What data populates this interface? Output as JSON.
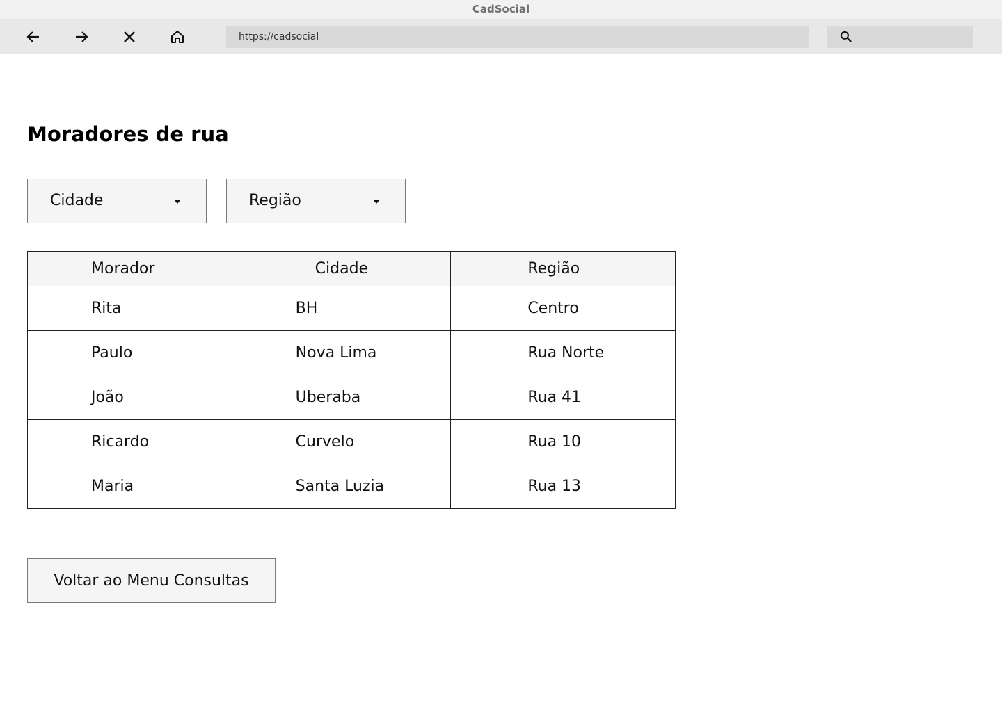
{
  "window": {
    "title": "CadSocial"
  },
  "browser": {
    "url": "https://cadsocial",
    "icons": {
      "back": "arrow-left-icon",
      "forward": "arrow-right-icon",
      "stop": "close-icon",
      "home": "home-icon",
      "search": "search-icon"
    }
  },
  "page": {
    "title": "Moradores de rua",
    "filters": {
      "city_label": "Cidade",
      "region_label": "Região"
    },
    "table": {
      "headers": [
        "Morador",
        "Cidade",
        "Região"
      ],
      "rows": [
        [
          "Rita",
          "BH",
          "Centro"
        ],
        [
          "Paulo",
          "Nova Lima",
          "Rua Norte"
        ],
        [
          "João",
          "Uberaba",
          "Rua 41"
        ],
        [
          "Ricardo",
          "Curvelo",
          "Rua 10"
        ],
        [
          "Maria",
          "Santa Luzia",
          "Rua 13"
        ]
      ]
    },
    "back_button_label": "Voltar ao Menu Consultas"
  }
}
